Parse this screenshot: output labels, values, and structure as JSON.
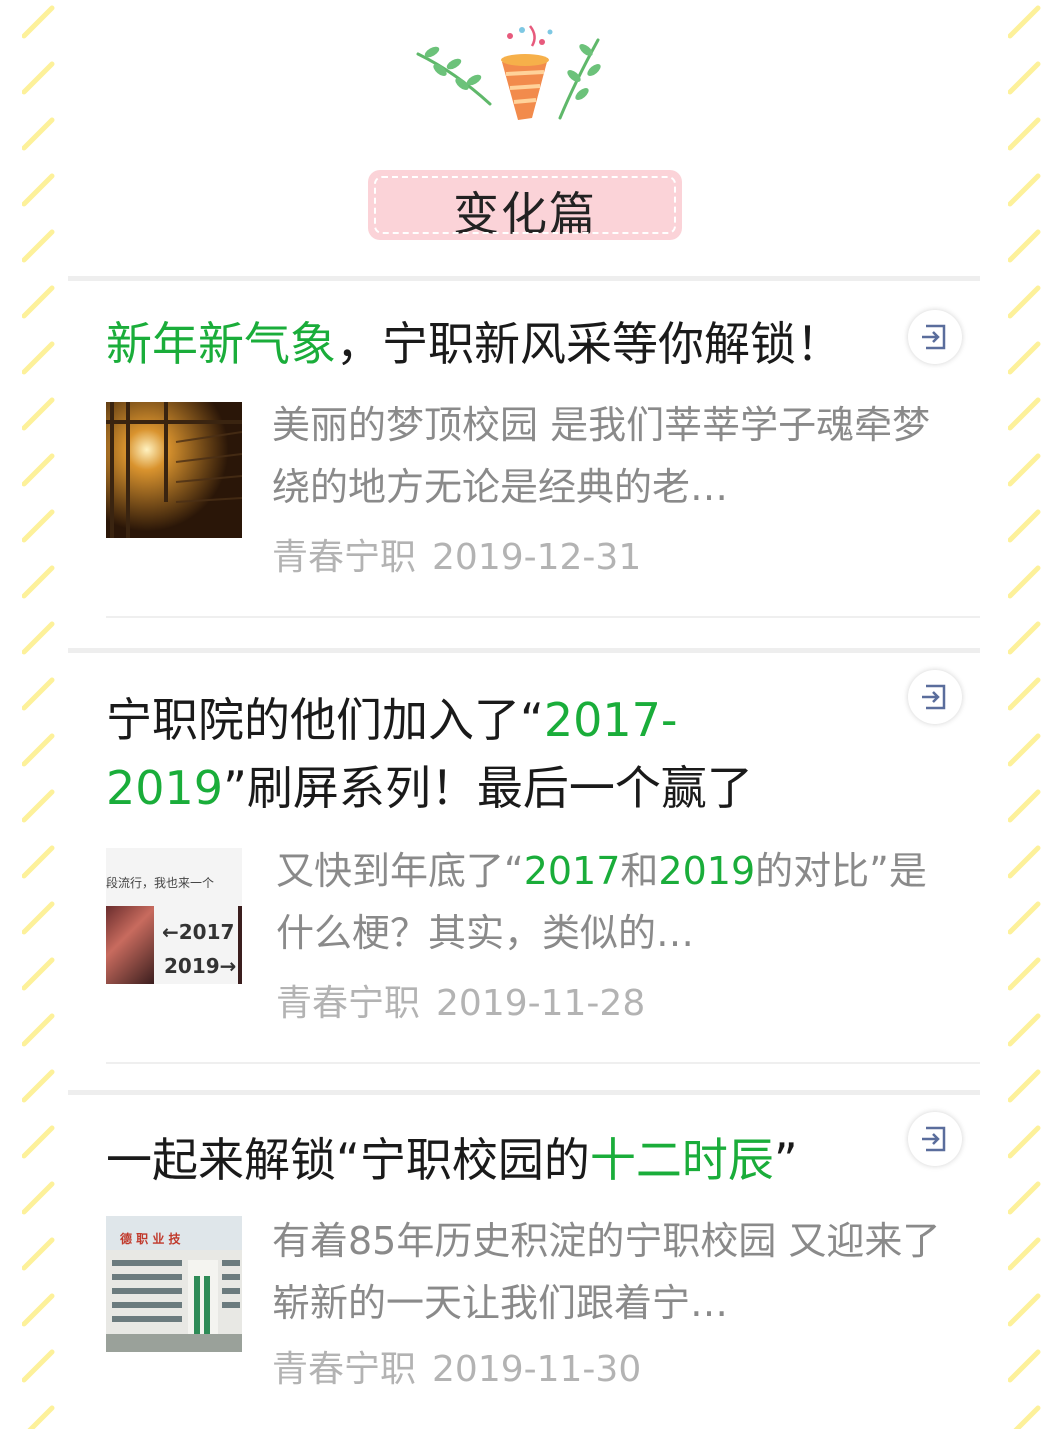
{
  "section": {
    "title": "变化篇"
  },
  "colors": {
    "accent": "#1aad3a",
    "tag_bg": "#fbd3d8",
    "stripe": "#fdf19a"
  },
  "articles": [
    {
      "title_green": "新年新气象",
      "title_rest": "，宁职新风采等你解锁！",
      "summary": "美丽的梦顶校园 是我们莘莘学子魂牵梦绕的地方无论是经典的老…",
      "account": "青春宁职",
      "date": "2019-12-31",
      "icon": "share-out-icon"
    },
    {
      "title_part1": "宁职院的他们加入了“",
      "title_green": "2017-2019",
      "title_part2": "”刷屏系列！最后一个赢了",
      "summary_part1": "又快到年底了“",
      "summary_green1": "2017",
      "summary_part2": "和",
      "summary_green2": "2019",
      "summary_part3": "的对比”是什么梗？其实，类似的…",
      "thumb_text_top": "段流行，我也来一个",
      "thumb_text_2017": "←2017",
      "thumb_text_2019": "2019→",
      "account": "青春宁职",
      "date": "2019-11-28",
      "icon": "share-out-icon"
    },
    {
      "title_part1": "一起来解锁“宁职校园的",
      "title_green": "十二时辰",
      "title_part2": "”",
      "summary": "有着85年历史积淀的宁职校园 又迎来了崭新的一天让我们跟着宁…",
      "thumb_sign": "德 职 业 技",
      "account": "青春宁职",
      "date": "2019-11-30",
      "icon": "share-out-icon"
    }
  ]
}
